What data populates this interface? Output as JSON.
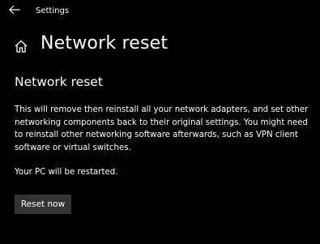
{
  "window": {
    "app_title": "Settings",
    "back_icon": "back-arrow-icon"
  },
  "header": {
    "home_icon": "home-icon",
    "title": "Network reset"
  },
  "section": {
    "title": "Network reset",
    "description": "This will remove then reinstall all your network adapters, and set other networking components back to their original settings. You might need to reinstall other networking software afterwards, such as VPN client software or virtual switches.",
    "restart_note": "Your PC will be restarted.",
    "reset_button_label": "Reset now"
  },
  "colors": {
    "background": "#000000",
    "text": "#ffffff",
    "button_background": "#333333"
  }
}
